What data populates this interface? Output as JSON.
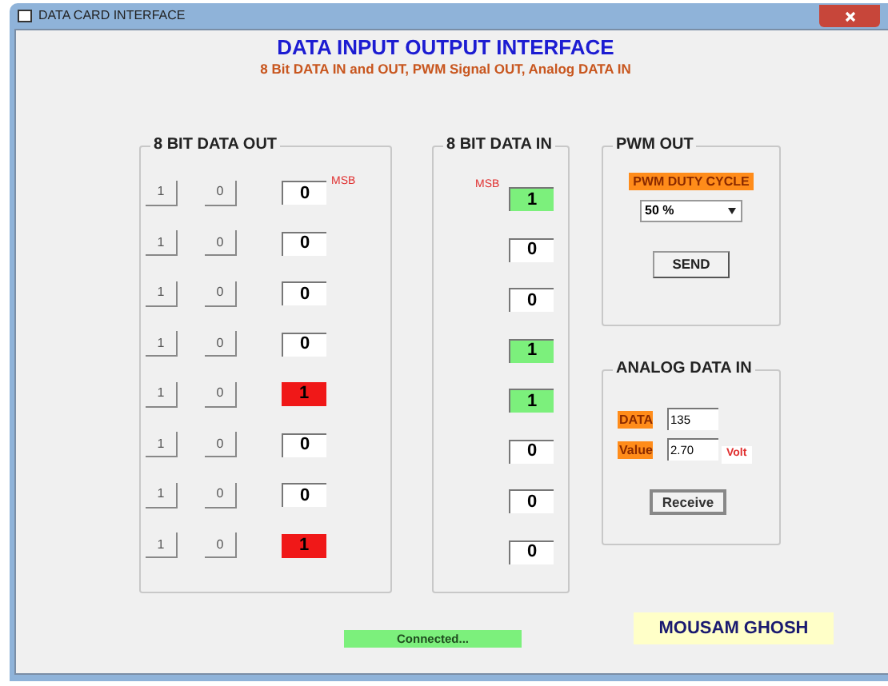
{
  "window": {
    "title": "DATA CARD INTERFACE"
  },
  "header": {
    "title": "DATA INPUT OUTPUT INTERFACE",
    "subtitle": "8 Bit DATA IN and OUT, PWM Signal OUT, Analog DATA IN"
  },
  "data_out": {
    "title": "8 BIT DATA OUT",
    "msb_label": "MSB",
    "bits": [
      {
        "set_label": "1",
        "clear_label": "0",
        "value": "0",
        "on": false
      },
      {
        "set_label": "1",
        "clear_label": "0",
        "value": "0",
        "on": false
      },
      {
        "set_label": "1",
        "clear_label": "0",
        "value": "0",
        "on": false
      },
      {
        "set_label": "1",
        "clear_label": "0",
        "value": "0",
        "on": false
      },
      {
        "set_label": "1",
        "clear_label": "0",
        "value": "1",
        "on": true
      },
      {
        "set_label": "1",
        "clear_label": "0",
        "value": "0",
        "on": false
      },
      {
        "set_label": "1",
        "clear_label": "0",
        "value": "0",
        "on": false
      },
      {
        "set_label": "1",
        "clear_label": "0",
        "value": "1",
        "on": true
      }
    ]
  },
  "data_in": {
    "title": "8 BIT DATA IN",
    "msb_label": "MSB",
    "bits": [
      {
        "value": "1",
        "on": true
      },
      {
        "value": "0",
        "on": false
      },
      {
        "value": "0",
        "on": false
      },
      {
        "value": "1",
        "on": true
      },
      {
        "value": "1",
        "on": true
      },
      {
        "value": "0",
        "on": false
      },
      {
        "value": "0",
        "on": false
      },
      {
        "value": "0",
        "on": false
      }
    ]
  },
  "pwm_out": {
    "title": "PWM OUT",
    "label": "PWM DUTY CYCLE",
    "duty_cycle": "50 %",
    "button": "SEND"
  },
  "analog_in": {
    "title": "ANALOG DATA IN",
    "data_label": "DATA",
    "data_value": "135",
    "value_label": "Value",
    "value": "2.70",
    "unit": "Volt",
    "button": "Receive"
  },
  "status": "Connected...",
  "author": "MOUSAM GHOSH"
}
